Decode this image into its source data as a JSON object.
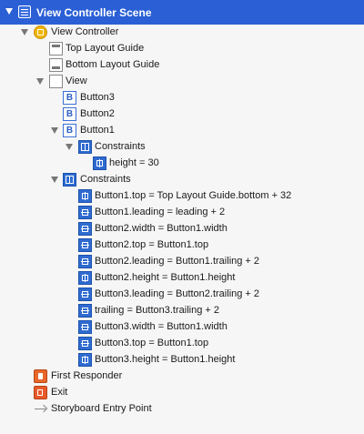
{
  "scene": {
    "title": "View Controller Scene"
  },
  "tree": {
    "view_controller": "View Controller",
    "top_layout_guide": "Top Layout Guide",
    "bottom_layout_guide": "Bottom Layout Guide",
    "view": "View",
    "button3": "Button3",
    "button2": "Button2",
    "button1": "Button1",
    "button1_constraints": "Constraints",
    "height_constraint": "height = 30",
    "view_constraints": "Constraints",
    "constraints": [
      "Button1.top = Top Layout Guide.bottom + 32",
      "Button1.leading = leading + 2",
      "Button2.width = Button1.width",
      "Button2.top = Button1.top",
      "Button2.leading = Button1.trailing + 2",
      "Button2.height = Button1.height",
      "Button3.leading = Button2.trailing + 2",
      "trailing = Button3.trailing + 2",
      "Button3.width = Button1.width",
      "Button3.top = Button1.top",
      "Button3.height = Button1.height"
    ],
    "first_responder": "First Responder",
    "exit": "Exit",
    "storyboard_entry_point": "Storyboard Entry Point"
  },
  "icons": {
    "button_glyph": "B",
    "scene": "scene-icon",
    "view_controller": "view-controller-icon",
    "layout_guide": "layout-guide-icon",
    "view": "view-icon",
    "button": "button-icon",
    "constraints": "constraints-icon",
    "constraint": "constraint-icon",
    "first_responder": "first-responder-icon",
    "exit": "exit-icon",
    "entry_point": "arrow-right-icon"
  },
  "colors": {
    "selection": "#2a5fd6",
    "constraint_icon": "#2f6bd0",
    "view_controller_icon": "#f0b400"
  }
}
